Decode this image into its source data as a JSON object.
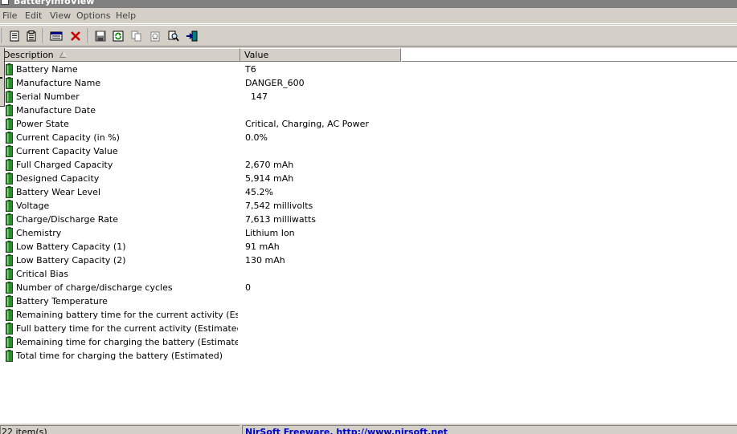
{
  "window": {
    "title": "BatteryInfoView"
  },
  "menu": [
    "File",
    "Edit",
    "View",
    "Options",
    "Help"
  ],
  "toolbar": {
    "icons": [
      "properties-icon",
      "report-icon",
      "window-icon",
      "delete-icon",
      "save-icon",
      "refresh-icon",
      "copy-icon",
      "html-report-icon",
      "find-icon",
      "exit-icon"
    ]
  },
  "columns": {
    "description": "Description",
    "value": "Value"
  },
  "rows": [
    {
      "description": "Battery Name",
      "value": "T6"
    },
    {
      "description": "Manufacture Name",
      "value": "DANGER_600"
    },
    {
      "description": "Serial Number",
      "value": "  147"
    },
    {
      "description": "Manufacture Date",
      "value": ""
    },
    {
      "description": "Power State",
      "value": "Critical, Charging, AC Power"
    },
    {
      "description": "Current Capacity (in %)",
      "value": "0.0%"
    },
    {
      "description": "Current Capacity Value",
      "value": ""
    },
    {
      "description": "Full Charged Capacity",
      "value": "2,670 mAh"
    },
    {
      "description": "Designed Capacity",
      "value": "5,914 mAh"
    },
    {
      "description": "Battery Wear Level",
      "value": "45.2%"
    },
    {
      "description": "Voltage",
      "value": "7,542 millivolts"
    },
    {
      "description": "Charge/Discharge Rate",
      "value": "7,613 milliwatts"
    },
    {
      "description": "Chemistry",
      "value": "Lithium Ion"
    },
    {
      "description": "Low Battery Capacity (1)",
      "value": "91 mAh"
    },
    {
      "description": "Low Battery Capacity (2)",
      "value": "130 mAh"
    },
    {
      "description": "Critical Bias",
      "value": ""
    },
    {
      "description": "Number of charge/discharge cycles",
      "value": "0"
    },
    {
      "description": "Battery Temperature",
      "value": ""
    },
    {
      "description": "Remaining battery time for the current activity (Estima...",
      "value": ""
    },
    {
      "description": "Full battery time for the current activity (Estimated)",
      "value": ""
    },
    {
      "description": "Remaining time for charging the battery (Estimated)",
      "value": ""
    },
    {
      "description": "Total  time for charging the battery (Estimated)",
      "value": ""
    }
  ],
  "status": {
    "item_count": "22 item(s)",
    "link": "NirSoft Freeware.  http://www.nirsoft.net"
  },
  "colors": {
    "battery": "#2e8b2e",
    "link": "#0000cc",
    "chrome": "#d4d0c8"
  }
}
